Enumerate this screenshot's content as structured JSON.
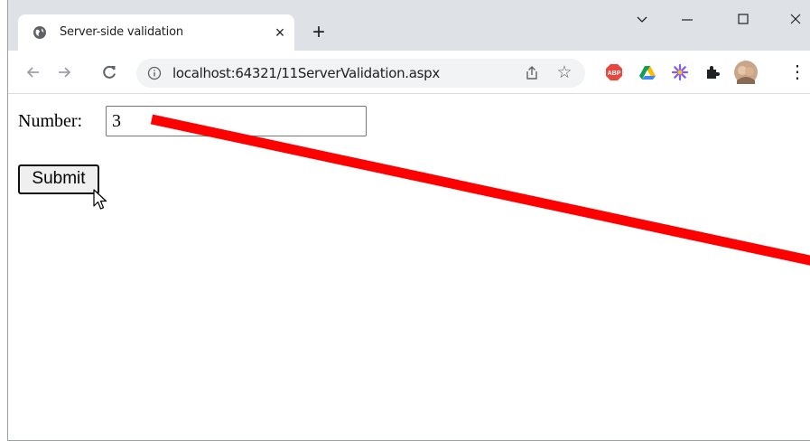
{
  "tab": {
    "title": "Server-side validation",
    "close_label": "×",
    "new_tab_label": "+"
  },
  "window_controls": {
    "dropdown": "⌵",
    "minimize": "—",
    "maximize": "☐",
    "close": "✕"
  },
  "toolbar": {
    "back": "←",
    "forward": "→",
    "reload": "C",
    "url": "localhost:64321/11ServerValidation.aspx",
    "share": "⇪",
    "bookmark": "☆",
    "menu": "⋮"
  },
  "extensions": [
    "adblock-plus-icon",
    "google-drive-icon",
    "asterisk-extension-icon",
    "puzzle-extensions-icon",
    "profile-avatar"
  ],
  "form": {
    "number_label": "Number:",
    "number_value": "3",
    "submit_label": "Submit"
  },
  "colors": {
    "annotation_line": "#ff0000",
    "tabstrip": "#dee1e6",
    "omnibox": "#f1f3f4"
  }
}
